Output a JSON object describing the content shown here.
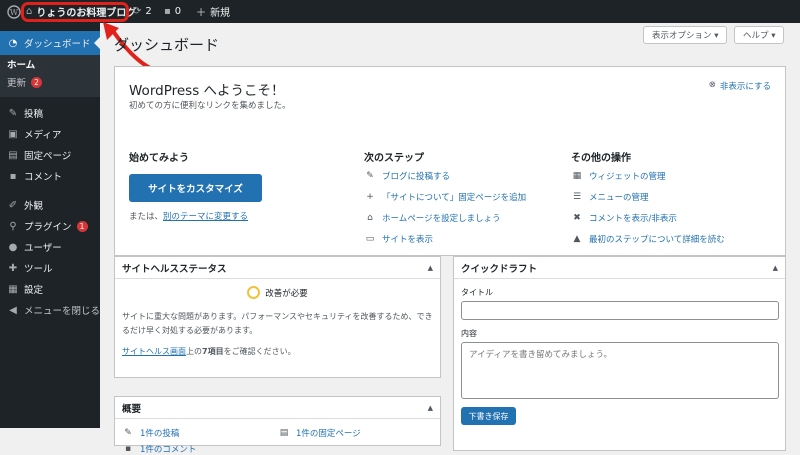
{
  "adminbar": {
    "site_name": "りょうのお料理ブログ",
    "updates_count": "2",
    "comments_count": "0",
    "new_label": "新規"
  },
  "sidebar": {
    "dashboard": "ダッシュボード",
    "home": "ホーム",
    "updates": "更新",
    "updates_badge": "2",
    "posts": "投稿",
    "media": "メディア",
    "pages": "固定ページ",
    "comments": "コメント",
    "appearance": "外観",
    "plugins": "プラグイン",
    "plugins_badge": "1",
    "users": "ユーザー",
    "tools": "ツール",
    "settings": "設定",
    "collapse": "メニューを閉じる"
  },
  "screen_options": "表示オプション ▾",
  "help": "ヘルプ ▾",
  "page_title": "ダッシュボード",
  "welcome": {
    "title": "WordPress へようこそ！",
    "subtitle": "初めての方に便利なリンクを集めました。",
    "dismiss": "非表示にする",
    "get_started": "始めてみよう",
    "customize_button": "サイトをカスタマイズ",
    "or_text": "または、",
    "change_theme": "別のテーマに変更する",
    "next_steps": "次のステップ",
    "next_items": [
      "ブログに投稿する",
      "「サイトについて」固定ページを追加",
      "ホームページを設定しましょう",
      "サイトを表示"
    ],
    "more_actions": "その他の操作",
    "more_items": [
      "ウィジェットの管理",
      "メニューの管理",
      "コメントを表示/非表示",
      "最初のステップについて詳細を読む"
    ]
  },
  "site_health": {
    "title": "サイトヘルスステータス",
    "status": "改善が必要",
    "description": "サイトに重大な問題があります。パフォーマンスやセキュリティを改善するため、できるだけ早く対処する必要があります。",
    "link_text": "サイトヘルス画面",
    "after_link": "上の",
    "item_count": "7項目",
    "after_count": "をご確認ください。"
  },
  "at_a_glance": {
    "title": "概要",
    "posts": "1件の投稿",
    "pages": "1件の固定ページ",
    "comments": "1件のコメント"
  },
  "quick_draft": {
    "title": "クイックドラフト",
    "title_label": "タイトル",
    "content_label": "内容",
    "content_placeholder": "アイディアを書き留めてみましょう。",
    "save_button": "下書き保存"
  },
  "annotation_color": "#e0221b"
}
